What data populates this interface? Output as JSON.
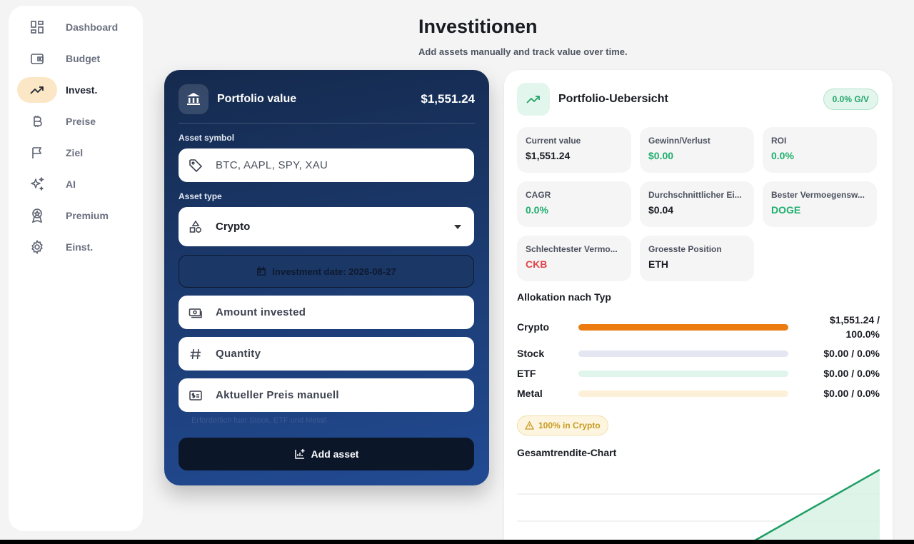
{
  "sidebar": {
    "items": [
      {
        "label": "Dashboard",
        "icon": "dashboard-icon"
      },
      {
        "label": "Budget",
        "icon": "wallet-icon"
      },
      {
        "label": "Invest.",
        "icon": "trending-up-icon",
        "active": true
      },
      {
        "label": "Preise",
        "icon": "bitcoin-icon"
      },
      {
        "label": "Ziel",
        "icon": "flag-icon"
      },
      {
        "label": "AI",
        "icon": "sparkles-icon"
      },
      {
        "label": "Premium",
        "icon": "award-icon"
      },
      {
        "label": "Einst.",
        "icon": "gear-icon"
      }
    ]
  },
  "header": {
    "title": "Investitionen",
    "subtitle": "Add assets manually and track value over time."
  },
  "form": {
    "portfolio_label": "Portfolio value",
    "portfolio_value": "$1,551.24",
    "symbol_label": "Asset symbol",
    "symbol_placeholder": "BTC, AAPL, SPY, XAU",
    "type_label": "Asset type",
    "type_value": "Crypto",
    "date_button": "Investment date: 2026-08-27",
    "amount_placeholder": "Amount invested",
    "quantity_placeholder": "Quantity",
    "price_placeholder": "Aktueller Preis manuell",
    "hint": "Erforderlich fuer Stock, ETF und Metall",
    "add_button": "Add asset"
  },
  "overview": {
    "title": "Portfolio-Uebersicht",
    "badge": "0.0% G/V",
    "stats": [
      {
        "label": "Current value",
        "value": "$1,551.24"
      },
      {
        "label": "Gewinn/Verlust",
        "value": "$0.00"
      },
      {
        "label": "ROI",
        "value": "0.0%"
      },
      {
        "label": "CAGR",
        "value": "0.0%"
      },
      {
        "label": "Durchschnittlicher Ei...",
        "value": "$0.04"
      },
      {
        "label": "Bester Vermoegensw...",
        "value": "DOGE"
      },
      {
        "label": "Schlechtester Vermo...",
        "value": "CKB"
      },
      {
        "label": "Groesste Position",
        "value": "ETH"
      }
    ],
    "allocation_title": "Allokation nach Typ",
    "allocation": [
      {
        "name": "Crypto",
        "value_line1": "$1,551.24 /",
        "value_line2": "100.0%",
        "fraction": 1.0,
        "color": "#ec7c12"
      },
      {
        "name": "Stock",
        "value": "$0.00 / 0.0%",
        "fraction": 0,
        "color": "#e4e6f2"
      },
      {
        "name": "ETF",
        "value": "$0.00 / 0.0%",
        "fraction": 0,
        "color": "#e0f5ec"
      },
      {
        "name": "Metal",
        "value": "$0.00 / 0.0%",
        "fraction": 0,
        "color": "#fcf0d8"
      }
    ],
    "warning": "100% in Crypto",
    "chart_title": "Gesamtrendite-Chart"
  },
  "colors": {
    "accent_orange": "#ec7c12",
    "green": "#1fae6e",
    "red": "#e0464a",
    "form_gradient_top": "#152a4d",
    "form_gradient_bottom": "#224b94"
  }
}
